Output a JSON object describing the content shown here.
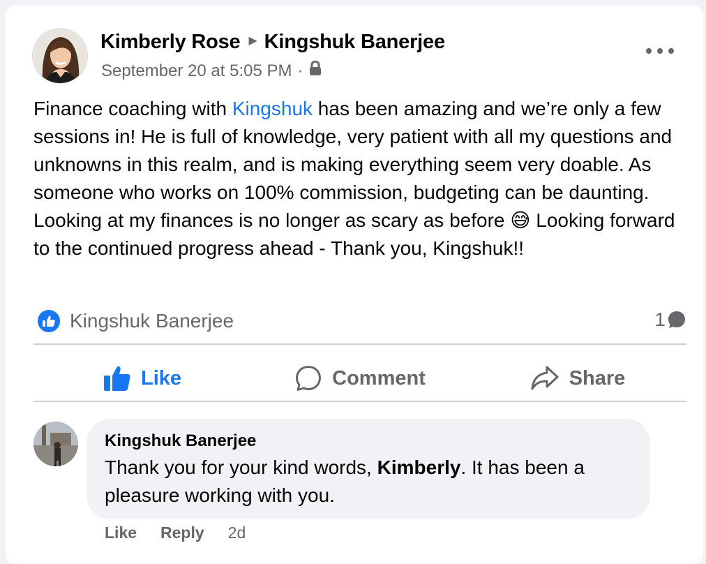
{
  "post": {
    "author": "Kimberly Rose",
    "target": "Kingshuk Banerjee",
    "timestamp": "September 20 at 5:05 PM",
    "separator": "·",
    "privacy_icon": "lock-icon",
    "text_before_mention": "Finance coaching with ",
    "mention": "Kingshuk",
    "text_before_emoji": " has been amazing and we’re only a few sessions in! He is full of knowledge, very patient with all my questions and unknowns in this realm, and is making everything seem very doable. As someone who works on 100% commission, budgeting can be daunting. Looking at my finances is no longer as scary as before ",
    "emoji": "😅",
    "text_after_emoji": " Looking forward to the continued progress ahead - Thank you, Kingshuk!!"
  },
  "reactions": {
    "reactor": "Kingshuk Banerjee",
    "comment_count": "1"
  },
  "actions": {
    "like": "Like",
    "comment": "Comment",
    "share": "Share"
  },
  "comment": {
    "author": "Kingshuk Banerjee",
    "text_before": "Thank you for your kind words, ",
    "bold_name": "Kimberly",
    "text_after": ". It has been a pleasure working with you.",
    "like": "Like",
    "reply": "Reply",
    "time": "2d"
  },
  "colors": {
    "accent": "#1877f2",
    "secondary_text": "#65676b",
    "bubble": "#f0f2f5"
  }
}
